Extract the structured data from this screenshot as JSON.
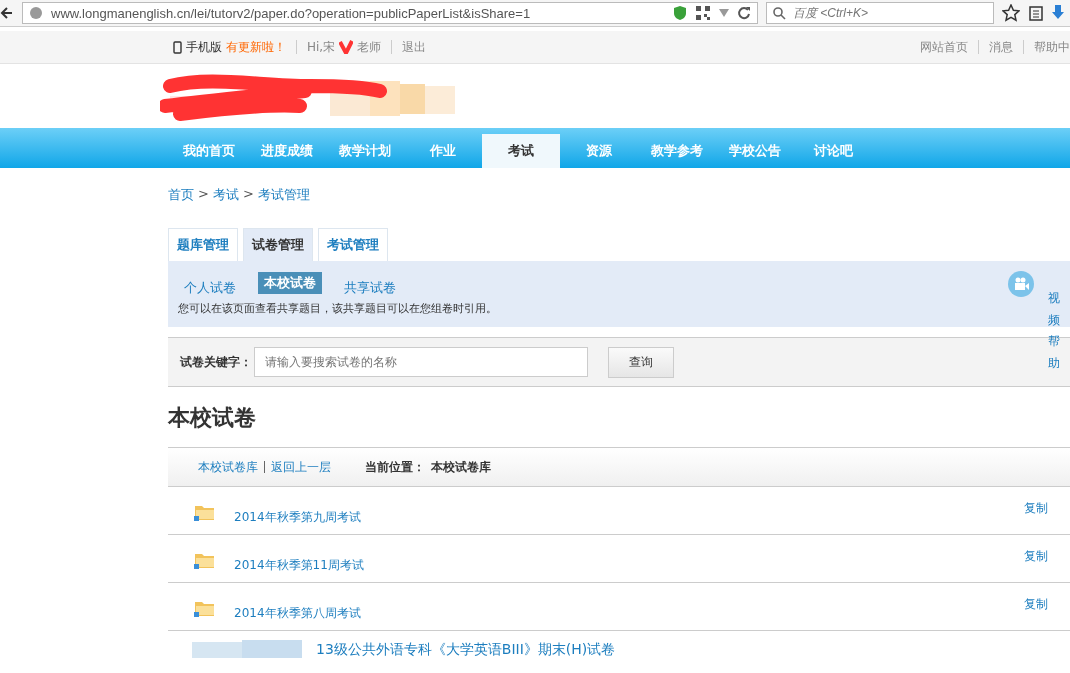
{
  "browser": {
    "url": "www.longmanenglish.cn/lei/tutorv2/paper.do?operation=publicPaperList&isShare=1",
    "search_placeholder": "百度 <Ctrl+K>"
  },
  "topbar": {
    "mobile": "手机版",
    "update": "有更新啦！",
    "greeting": "Hi,宋",
    "greeting_end": "老师",
    "logout": "退出",
    "links": [
      "网站首页",
      "消息",
      "帮助中"
    ]
  },
  "nav": [
    {
      "label": "我的首页",
      "selected": false
    },
    {
      "label": "进度成绩",
      "selected": false
    },
    {
      "label": "教学计划",
      "selected": false
    },
    {
      "label": "作业",
      "selected": false
    },
    {
      "label": "考试",
      "selected": true
    },
    {
      "label": "资源",
      "selected": false
    },
    {
      "label": "教学参考",
      "selected": false
    },
    {
      "label": "学校公告",
      "selected": false
    },
    {
      "label": "讨论吧",
      "selected": false
    }
  ],
  "breadcrumb": [
    "首页",
    "考试",
    "考试管理"
  ],
  "breadcrumb_separator": ">",
  "tabs": [
    {
      "label": "题库管理",
      "selected": false
    },
    {
      "label": "试卷管理",
      "selected": true
    },
    {
      "label": "考试管理",
      "selected": false
    }
  ],
  "subtabs": [
    {
      "label": "个人试卷",
      "selected": false
    },
    {
      "label": "本校试卷",
      "selected": true
    },
    {
      "label": "共享试卷",
      "selected": false
    }
  ],
  "notice": "您可以在该页面查看共享题目，该共享题目可以在您组卷时引用。",
  "video_help": "视频帮助",
  "search": {
    "label": "试卷关键字：",
    "placeholder": "请输入要搜索试卷的名称",
    "button": "查询"
  },
  "heading": "本校试卷",
  "pathbar": {
    "links": [
      "本校试卷库",
      "返回上一层"
    ],
    "location_label": "当前位置：",
    "location": "本校试卷库"
  },
  "papers": [
    {
      "title": "2014年秋季第九周考试",
      "action": "复制"
    },
    {
      "title": "2014年秋季第11周考试",
      "action": "复制"
    },
    {
      "title": "2014年秋季第八周考试",
      "action": "复制"
    }
  ],
  "last_paper": "13级公共外语专科《大学英语BIII》期末(H)试卷"
}
